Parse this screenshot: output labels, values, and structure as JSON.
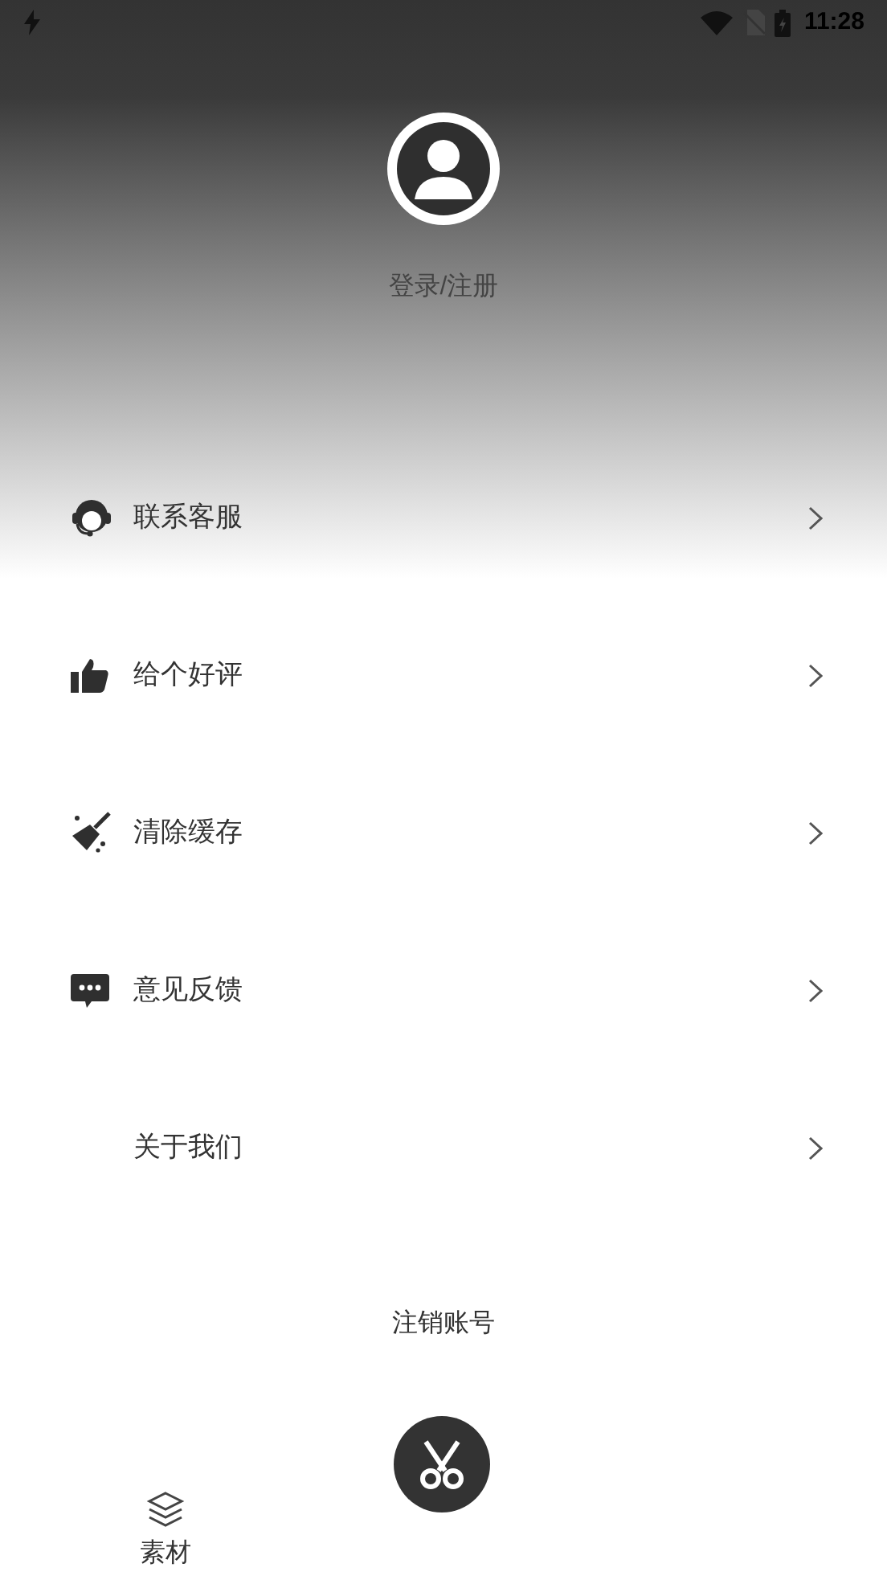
{
  "status_bar": {
    "time": "11:28"
  },
  "profile": {
    "login_label": "登录/注册"
  },
  "menu": [
    {
      "label": "联系客服"
    },
    {
      "label": "给个好评"
    },
    {
      "label": "清除缓存"
    },
    {
      "label": "意见反馈"
    },
    {
      "label": "关于我们"
    }
  ],
  "logout_label": "注销账号",
  "bottom_nav": {
    "tabs": [
      {
        "label": "素材"
      }
    ]
  }
}
